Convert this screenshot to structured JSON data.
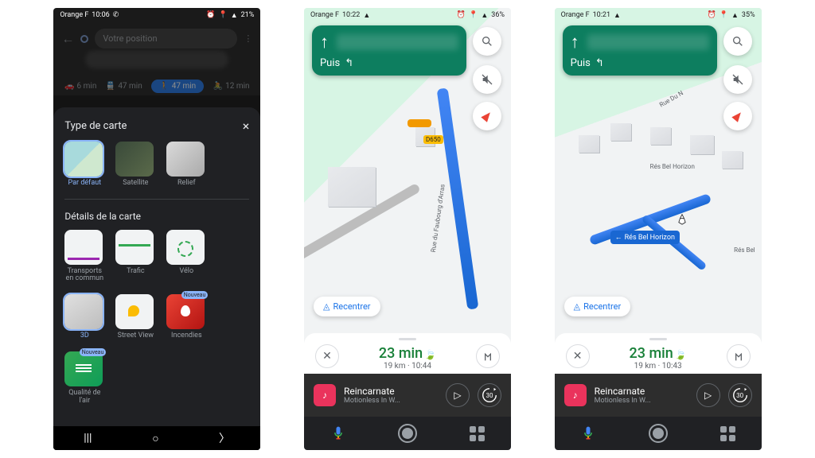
{
  "phone1": {
    "status": {
      "carrier": "Orange F",
      "time": "10:06",
      "battery": "21%"
    },
    "search_placeholder": "Votre position",
    "modes": {
      "car": "6 min",
      "transit": "47 min",
      "walk": "47 min",
      "bike": "12 min"
    },
    "sheet": {
      "title": "Type de carte",
      "close": "×",
      "maptypes": {
        "default": "Par défaut",
        "satellite": "Satellite",
        "relief": "Relief"
      },
      "details_title": "Détails de la carte",
      "details": {
        "transit": "Transports\nen commun",
        "trafic": "Trafic",
        "velo": "Vélo",
        "d3": "3D",
        "streetview": "Street View",
        "incendies": "Incendies",
        "air": "Qualité de\nl'air",
        "new_badge": "Nouveau"
      }
    }
  },
  "phone2": {
    "status": {
      "carrier": "Orange F",
      "time": "10:22",
      "battery": "36%"
    },
    "nav": {
      "then": "Puis"
    },
    "marker": "D650",
    "street1": "Rue du Faubourg d'Arras",
    "street2": "Rue du Faubourg d'Arras",
    "recenter": "Recentrer",
    "eta": "23 min",
    "dist": "19 km",
    "arrival": "10:44",
    "music": {
      "title": "Reincarnate",
      "artist": "Motionless In W...",
      "skip": "30"
    }
  },
  "phone3": {
    "status": {
      "carrier": "Orange F",
      "time": "10:21",
      "battery": "35%"
    },
    "nav": {
      "then": "Puis"
    },
    "street1": "Rés Bel Horizon",
    "street2": "Rue Du N",
    "street3": "Rés Bel",
    "dest_label": "Rés Bel Horizon",
    "recenter": "Recentrer",
    "eta": "23 min",
    "dist": "19 km",
    "arrival": "10:43",
    "music": {
      "title": "Reincarnate",
      "artist": "Motionless In W...",
      "skip": "30"
    }
  }
}
